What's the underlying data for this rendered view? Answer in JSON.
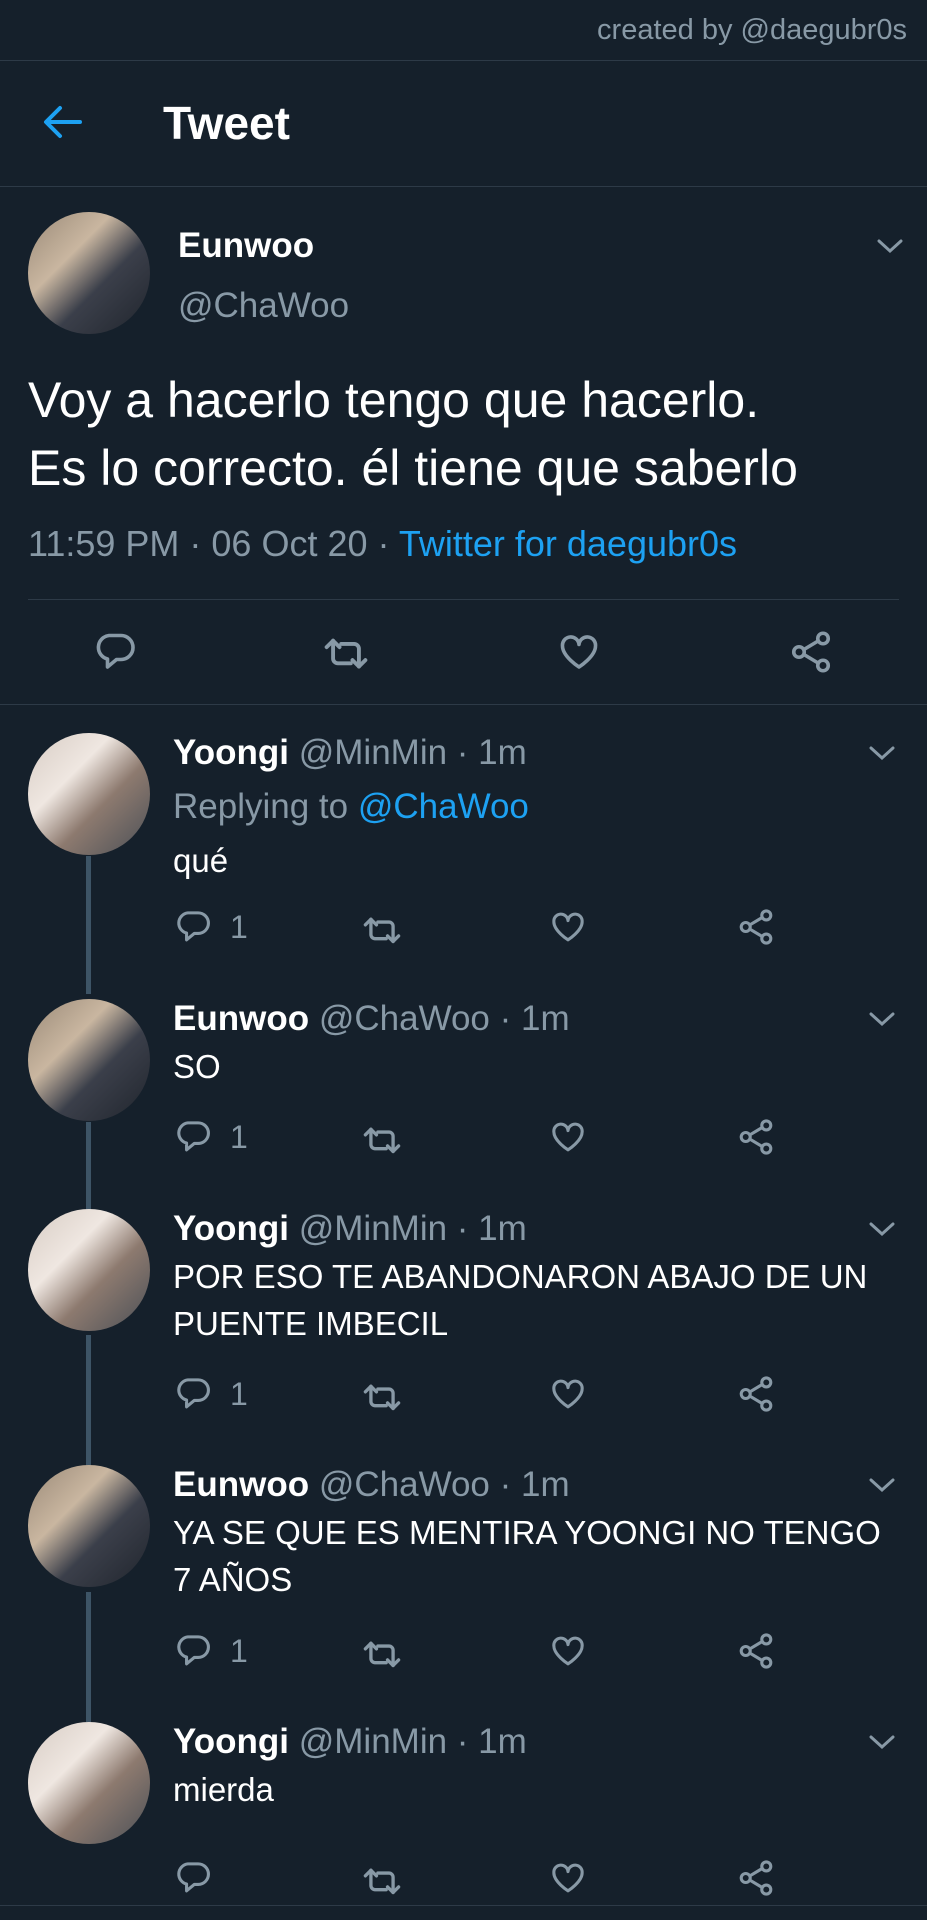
{
  "credit": "created by @daegubr0s",
  "header": {
    "title": "Tweet",
    "back_icon": "arrow-left-icon"
  },
  "colors": {
    "background": "#15202b",
    "accent": "#1da1f2",
    "muted": "#8899a6",
    "divider": "#2d3a47"
  },
  "main_tweet": {
    "name": "Eunwoo",
    "handle": "@ChaWoo",
    "text_line1": "Voy a hacerlo tengo que hacerlo.",
    "text_line2": "Es lo correcto. él tiene que saberlo",
    "time": "11:59 PM · 06 Oct 20 · ",
    "source": "Twitter for daegubr0s",
    "actions": [
      "reply-icon",
      "retweet-icon",
      "like-icon",
      "share-icon"
    ]
  },
  "replies": [
    {
      "name": "Yoongi",
      "handle": "@MinMin · 1m",
      "replying_prefix": "Replying to ",
      "replying_to": "@ChaWoo",
      "line1": "qué",
      "line2": "",
      "reply_count": "1"
    },
    {
      "name": "Eunwoo",
      "handle": "@ChaWoo · 1m",
      "line1": "SO",
      "line2": "",
      "reply_count": "1"
    },
    {
      "name": "Yoongi",
      "handle": "@MinMin · 1m",
      "line1": "POR ESO TE ABANDONARON ABAJO DE UN",
      "line2": "PUENTE IMBECIL",
      "reply_count": "1"
    },
    {
      "name": "Eunwoo",
      "handle": "@ChaWoo · 1m",
      "line1": "YA SE QUE ES MENTIRA YOONGI NO TENGO",
      "line2": "7 AÑOS",
      "reply_count": "1"
    },
    {
      "name": "Yoongi",
      "handle": "@MinMin · 1m",
      "line1": "mierda",
      "line2": "",
      "reply_count": ""
    }
  ]
}
